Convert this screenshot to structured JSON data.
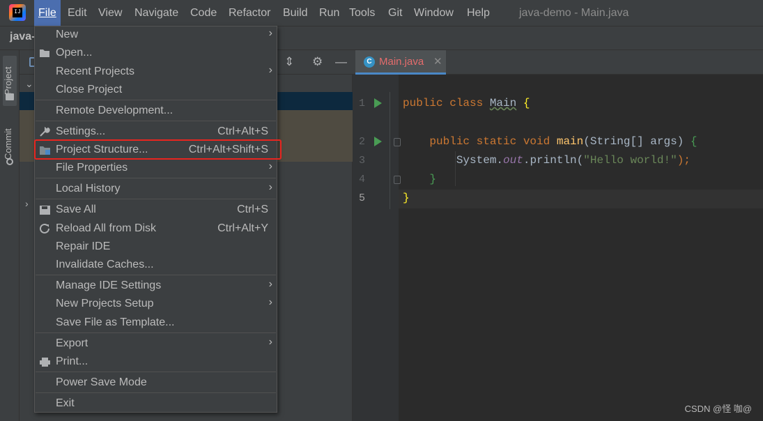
{
  "app": {
    "window_title": "java-demo - Main.java",
    "nav_project": "java-"
  },
  "menubar": {
    "items": [
      {
        "label": "File"
      },
      {
        "label": "Edit"
      },
      {
        "label": "View"
      },
      {
        "label": "Navigate"
      },
      {
        "label": "Code"
      },
      {
        "label": "Refactor"
      },
      {
        "label": "Build"
      },
      {
        "label": "Run"
      },
      {
        "label": "Tools"
      },
      {
        "label": "Git"
      },
      {
        "label": "Window"
      },
      {
        "label": "Help"
      }
    ]
  },
  "toolwindows": {
    "project": "Project",
    "commit": "Commit"
  },
  "editor": {
    "tab_title": "Main.java",
    "tab_icon": "C",
    "line_numbers": [
      "1",
      "2",
      "3",
      "4",
      "5"
    ],
    "code": {
      "l1_kw": "public class ",
      "l1_cls": "Main",
      "l1_brace": "{",
      "l2_kw": "public static void ",
      "l2_fn": "main",
      "l2_rest": "(String[] args) ",
      "l2_brace": "{",
      "l3_a": "System.",
      "l3_out": "out",
      "l3_b": ".println(",
      "l3_str": "\"Hello world!\"",
      "l3_c": ");",
      "l4": "}",
      "l5": "}"
    }
  },
  "file_menu": {
    "items": [
      {
        "label": "New",
        "shortcut": "",
        "submenu": true
      },
      {
        "label": "Open...",
        "shortcut": "",
        "submenu": false
      },
      {
        "label": "Recent Projects",
        "shortcut": "",
        "submenu": true
      },
      {
        "label": "Close Project",
        "shortcut": "",
        "submenu": false
      },
      {
        "label": "Remote Development...",
        "shortcut": "",
        "submenu": false
      },
      {
        "label": "Settings...",
        "shortcut": "Ctrl+Alt+S",
        "submenu": false
      },
      {
        "label": "Project Structure...",
        "shortcut": "Ctrl+Alt+Shift+S",
        "submenu": false,
        "highlighted": true
      },
      {
        "label": "File Properties",
        "shortcut": "",
        "submenu": true
      },
      {
        "label": "Local History",
        "shortcut": "",
        "submenu": true
      },
      {
        "label": "Save All",
        "shortcut": "Ctrl+S",
        "submenu": false
      },
      {
        "label": "Reload All from Disk",
        "shortcut": "Ctrl+Alt+Y",
        "submenu": false
      },
      {
        "label": "Repair IDE",
        "shortcut": "",
        "submenu": false
      },
      {
        "label": "Invalidate Caches...",
        "shortcut": "",
        "submenu": false
      },
      {
        "label": "Manage IDE Settings",
        "shortcut": "",
        "submenu": true
      },
      {
        "label": "New Projects Setup",
        "shortcut": "",
        "submenu": true
      },
      {
        "label": "Save File as Template...",
        "shortcut": "",
        "submenu": false
      },
      {
        "label": "Export",
        "shortcut": "",
        "submenu": true
      },
      {
        "label": "Print...",
        "shortcut": "",
        "submenu": false
      },
      {
        "label": "Power Save Mode",
        "shortcut": "",
        "submenu": false
      },
      {
        "label": "Exit",
        "shortcut": "",
        "submenu": false
      }
    ]
  },
  "icons": {
    "submenu": "chevron-right-icon",
    "open": "folder-open-icon",
    "settings": "wrench-icon",
    "project_structure": "project-structure-icon",
    "save": "floppy-disk-icon",
    "reload": "reload-icon",
    "print": "printer-icon"
  },
  "colors": {
    "highlight_box": "#e8251f",
    "menu_active": "#4b6eaf",
    "background": "#2b2b2b",
    "panel": "#3c3f41"
  },
  "watermark": "CSDN @怪 咖@"
}
